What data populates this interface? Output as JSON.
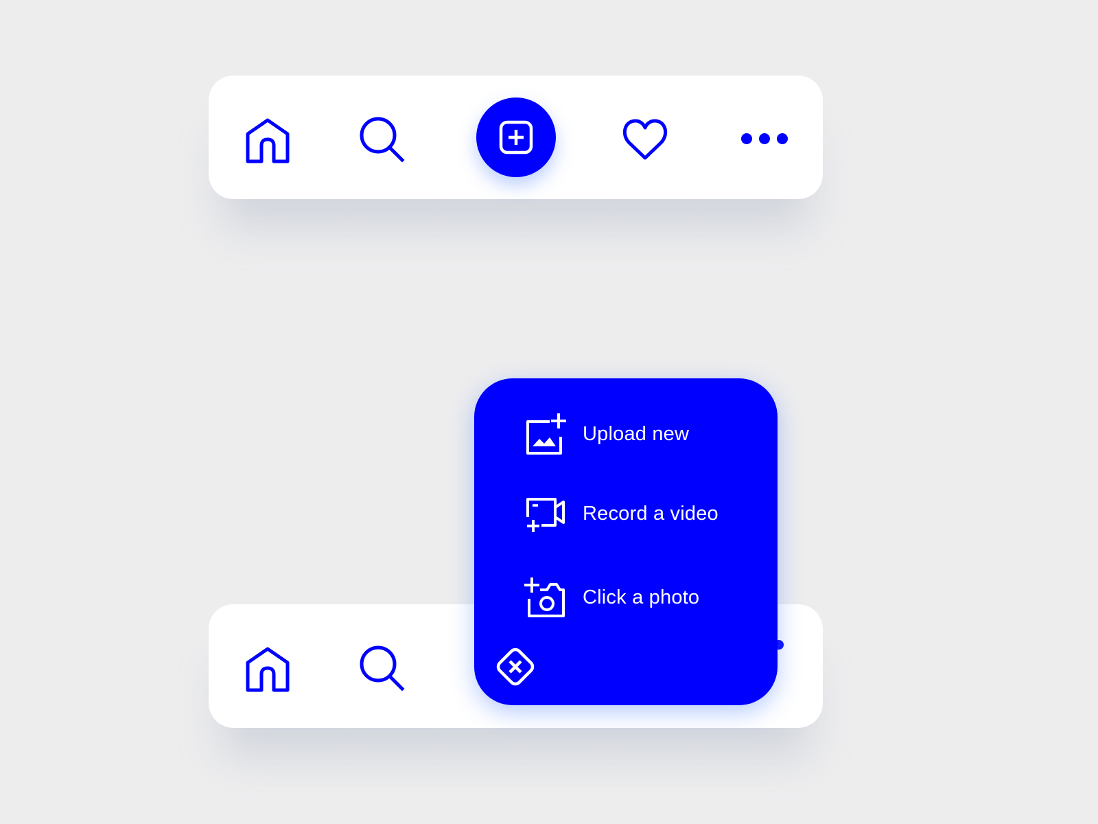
{
  "colors": {
    "accent": "#0000fe",
    "background": "#ededee",
    "surface": "#ffffff",
    "menu_text": "#ffffff"
  },
  "top_nav": {
    "items": [
      {
        "id": "home",
        "icon": "home-icon"
      },
      {
        "id": "search",
        "icon": "search-icon"
      },
      {
        "id": "add",
        "icon": "plus-square-icon"
      },
      {
        "id": "favorites",
        "icon": "heart-icon"
      },
      {
        "id": "more",
        "icon": "more-dots-icon"
      }
    ]
  },
  "bottom_nav": {
    "items": [
      {
        "id": "home",
        "icon": "home-icon"
      },
      {
        "id": "search",
        "icon": "search-icon"
      }
    ]
  },
  "create_menu": {
    "items": [
      {
        "label": "Upload new",
        "icon": "image-plus-icon"
      },
      {
        "label": "Record a video",
        "icon": "video-plus-icon"
      },
      {
        "label": "Click a photo",
        "icon": "camera-plus-icon"
      }
    ],
    "close_icon": "close-diamond-icon"
  }
}
